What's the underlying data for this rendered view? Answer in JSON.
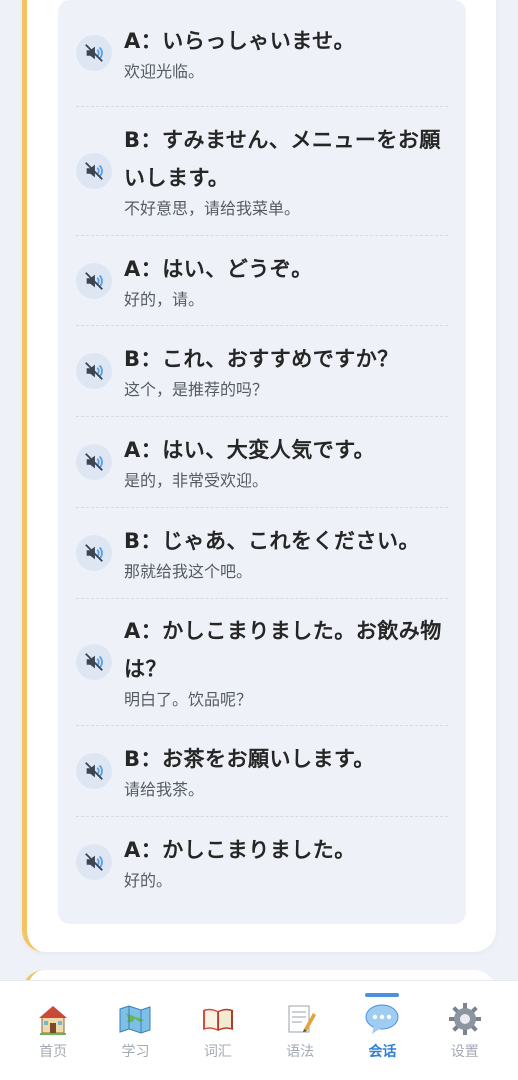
{
  "dialogue": [
    {
      "speaker": "A",
      "jp": "A：いらっしゃいませ。",
      "cn": "欢迎光临。"
    },
    {
      "speaker": "B",
      "jp": "B：すみません、メニューをお願いします。",
      "cn": "不好意思，请给我菜单。"
    },
    {
      "speaker": "A",
      "jp": "A：はい、どうぞ。",
      "cn": "好的，请。"
    },
    {
      "speaker": "B",
      "jp": "B：これ、おすすめですか？",
      "cn": "这个，是推荐的吗？"
    },
    {
      "speaker": "A",
      "jp": "A：はい、大変人気です。",
      "cn": "是的，非常受欢迎。"
    },
    {
      "speaker": "B",
      "jp": "B：じゃあ、これをください。",
      "cn": "那就给我这个吧。"
    },
    {
      "speaker": "A",
      "jp": "A：かしこまりました。お飲み物は？",
      "cn": "明白了。饮品呢？"
    },
    {
      "speaker": "B",
      "jp": "B：お茶をお願いします。",
      "cn": "请给我茶。"
    },
    {
      "speaker": "A",
      "jp": "A：かしこまりました。",
      "cn": "好的。"
    }
  ],
  "tabbar": {
    "tabs": [
      {
        "label": "首页",
        "icon": "house-icon"
      },
      {
        "label": "学习",
        "icon": "map-icon"
      },
      {
        "label": "词汇",
        "icon": "book-icon"
      },
      {
        "label": "语法",
        "icon": "memo-icon"
      },
      {
        "label": "会话",
        "icon": "speech-bubble-icon"
      },
      {
        "label": "设置",
        "icon": "gear-icon"
      }
    ],
    "active_index": 4
  },
  "colors": {
    "accent": "#2f7fd6",
    "card_border": "#f5c462",
    "background": "#eef2f8"
  }
}
